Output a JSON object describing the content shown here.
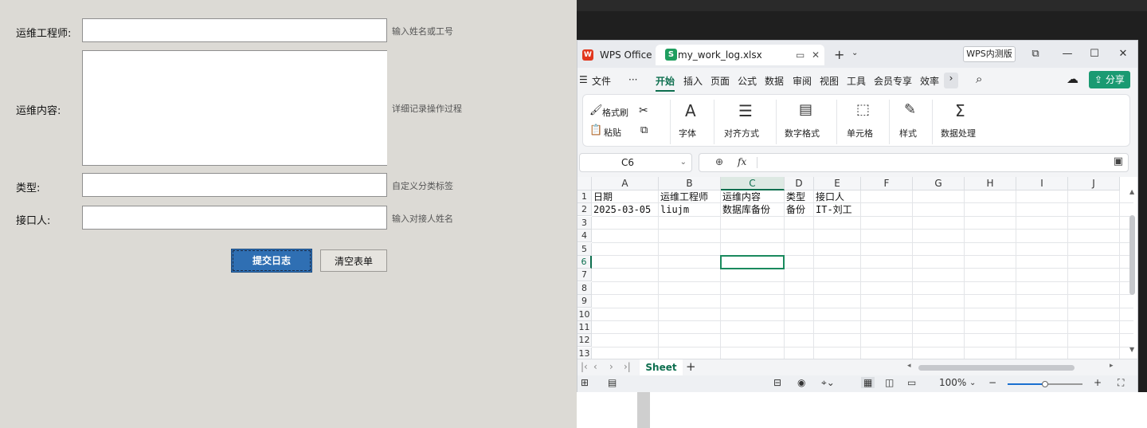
{
  "form": {
    "engineer_label": "运维工程师:",
    "engineer_value": "",
    "engineer_hint": "输入姓名或工号",
    "content_label": "运维内容:",
    "content_value": "",
    "content_hint": "详细记录操作过程",
    "type_label": "类型:",
    "type_value": "",
    "type_hint": "自定义分类标签",
    "receiver_label": "接口人:",
    "receiver_value": "",
    "receiver_hint": "输入对接人姓名",
    "submit_label": "提交日志",
    "clear_label": "清空表单"
  },
  "wps": {
    "app_tab": "WPS Office",
    "file_tab": "my_work_log.xlsx",
    "beta_badge": "WPS内测版",
    "menu": [
      "文件",
      "···",
      "开始",
      "插入",
      "页面",
      "公式",
      "数据",
      "审阅",
      "视图",
      "工具",
      "会员专享",
      "效率"
    ],
    "active_menu": "开始",
    "share_label": "分享",
    "ribbon": {
      "format_painter": "格式刷",
      "paste": "粘贴",
      "font": "字体",
      "align": "对齐方式",
      "number": "数字格式",
      "cells": "单元格",
      "styles": "样式",
      "data_proc": "数据处理"
    },
    "name_box": "C6",
    "fx_symbol": "fx",
    "columns": [
      "A",
      "B",
      "C",
      "D",
      "E",
      "F",
      "G",
      "H",
      "I",
      "J"
    ],
    "rows": [
      "1",
      "2",
      "3",
      "4",
      "5",
      "6",
      "7",
      "8",
      "9",
      "10",
      "11",
      "12",
      "13"
    ],
    "cells": {
      "A1": "日期",
      "B1": "运维工程师",
      "C1": "运维内容",
      "D1": "类型",
      "E1": "接口人",
      "A2": "2025-03-05",
      "B2": "liujm",
      "C2": "数据库备份",
      "D2": "备份",
      "E2": "IT-刘工"
    },
    "sheet_tab": "Sheet",
    "zoom": "100%",
    "zoom_level": 0.5,
    "accent_color": "#0e6f4f",
    "share_color": "#1a9a72"
  }
}
